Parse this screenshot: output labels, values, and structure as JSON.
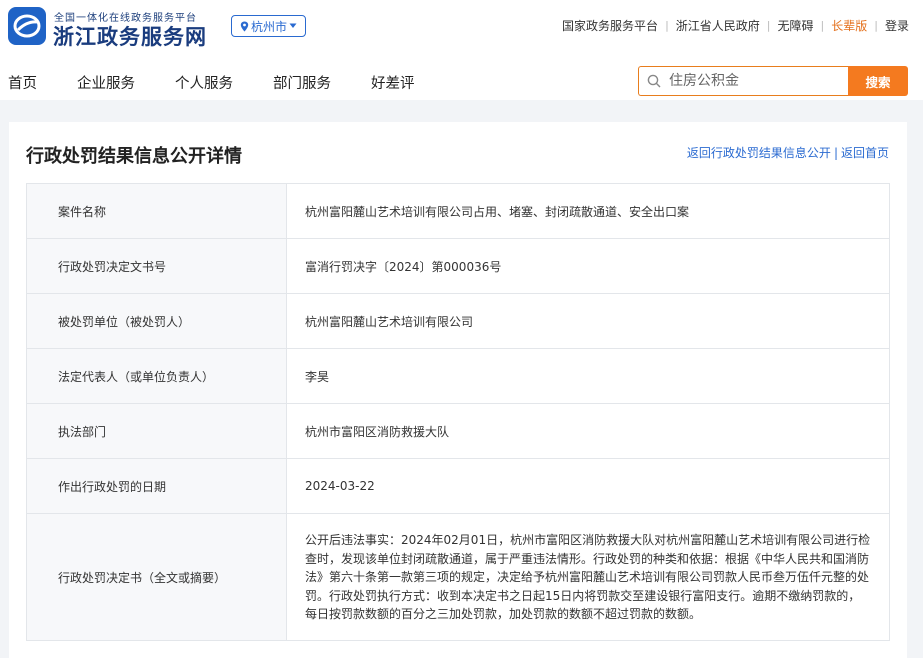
{
  "header": {
    "logo_subtitle": "全国一体化在线政务服务平台",
    "logo_title": "浙江政务服务网",
    "city": "杭州市",
    "top_links": [
      "国家政务服务平台",
      "浙江省人民政府",
      "无障碍",
      "长辈版",
      "登录"
    ]
  },
  "nav": {
    "items": [
      "首页",
      "企业服务",
      "个人服务",
      "部门服务",
      "好差评"
    ]
  },
  "search": {
    "placeholder": "住房公积金",
    "button_label": "搜索"
  },
  "page": {
    "title": "行政处罚结果信息公开详情",
    "back_link": "返回行政处罚结果信息公开",
    "home_link": "返回首页",
    "separator": "|"
  },
  "details": [
    {
      "label": "案件名称",
      "value": "杭州富阳麓山艺术培训有限公司占用、堵塞、封闭疏散通道、安全出口案"
    },
    {
      "label": "行政处罚决定文书号",
      "value": "富消行罚决字〔2024〕第000036号"
    },
    {
      "label": "被处罚单位（被处罚人）",
      "value": "杭州富阳麓山艺术培训有限公司"
    },
    {
      "label": "法定代表人（或单位负责人）",
      "value": "李昊"
    },
    {
      "label": "执法部门",
      "value": "杭州市富阳区消防救援大队"
    },
    {
      "label": "作出行政处罚的日期",
      "value": "2024-03-22"
    },
    {
      "label": "行政处罚决定书（全文或摘要）",
      "value": "公开后违法事实：2024年02月01日，杭州市富阳区消防救援大队对杭州富阳麓山艺术培训有限公司进行检查时，发现该单位封闭疏散通道，属于严重违法情形。行政处罚的种类和依据：根据《中华人民共和国消防法》第六十条第一款第三项的规定，决定给予杭州富阳麓山艺术培训有限公司罚款人民币叁万伍仟元整的处罚。行政处罚执行方式：收到本决定书之日起15日内将罚款交至建设银行富阳支行。逾期不缴纳罚款的，每日按罚款数额的百分之三加处罚款，加处罚款的数额不超过罚款的数额。"
    }
  ],
  "colors": {
    "brand_blue": "#1f63c6",
    "link_blue": "#2b6bd1",
    "accent_orange": "#f47a1f"
  }
}
